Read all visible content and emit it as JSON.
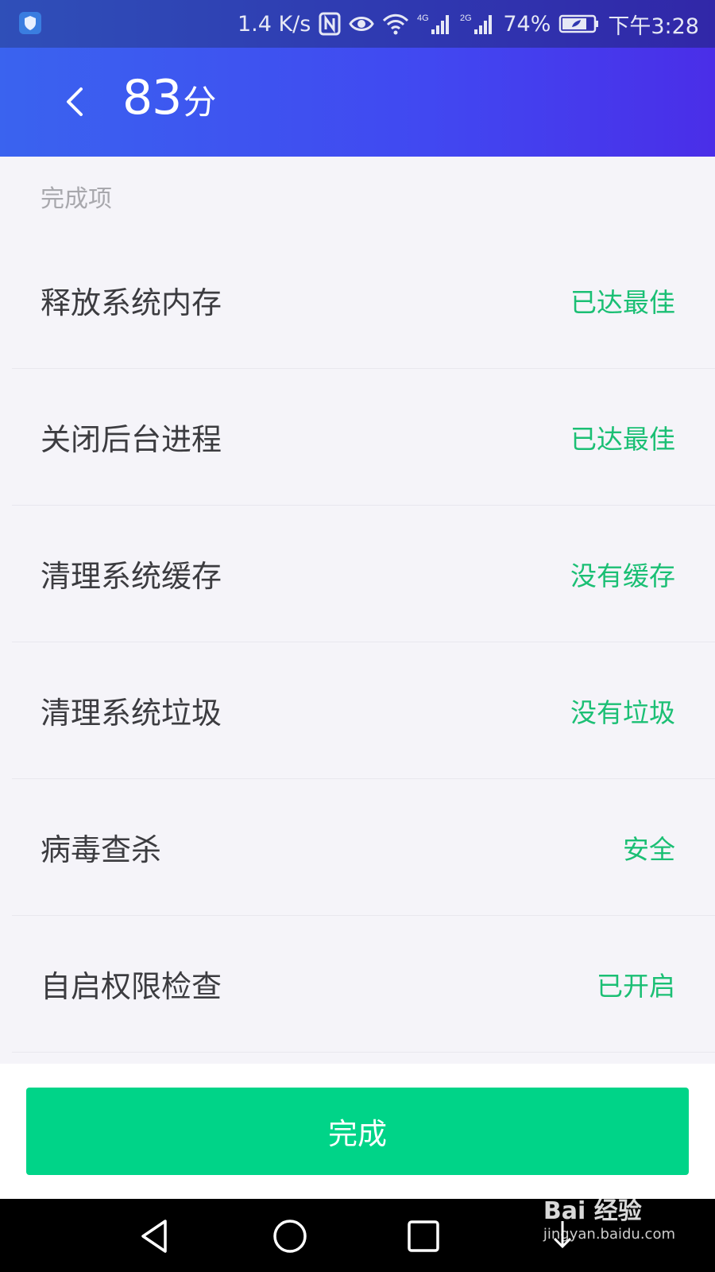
{
  "status_bar": {
    "network_speed": "1.4 K/s",
    "nfc_icon": "nfc-icon",
    "eye_icon": "eye-comfort-icon",
    "wifi_icon": "wifi-icon",
    "signal_4g_label": "4G",
    "signal_2g_label": "2G",
    "battery_percent": "74%",
    "time": "下午3:28"
  },
  "header": {
    "score": "83",
    "score_unit": "分"
  },
  "section": {
    "title": "完成项"
  },
  "items": [
    {
      "label": "释放系统内存",
      "status": "已达最佳"
    },
    {
      "label": "关闭后台进程",
      "status": "已达最佳"
    },
    {
      "label": "清理系统缓存",
      "status": "没有缓存"
    },
    {
      "label": "清理系统垃圾",
      "status": "没有垃圾"
    },
    {
      "label": "病毒查杀",
      "status": "安全"
    },
    {
      "label": "自启权限检查",
      "status": "已开启"
    }
  ],
  "footer": {
    "done_label": "完成"
  },
  "watermark": {
    "main": "Bai 经验",
    "sub": "jingyan.baidu.com"
  },
  "colors": {
    "header_start": "#3a63ef",
    "header_end": "#4a2ee8",
    "status_green": "#1bbf74",
    "button_green": "#00d488"
  }
}
